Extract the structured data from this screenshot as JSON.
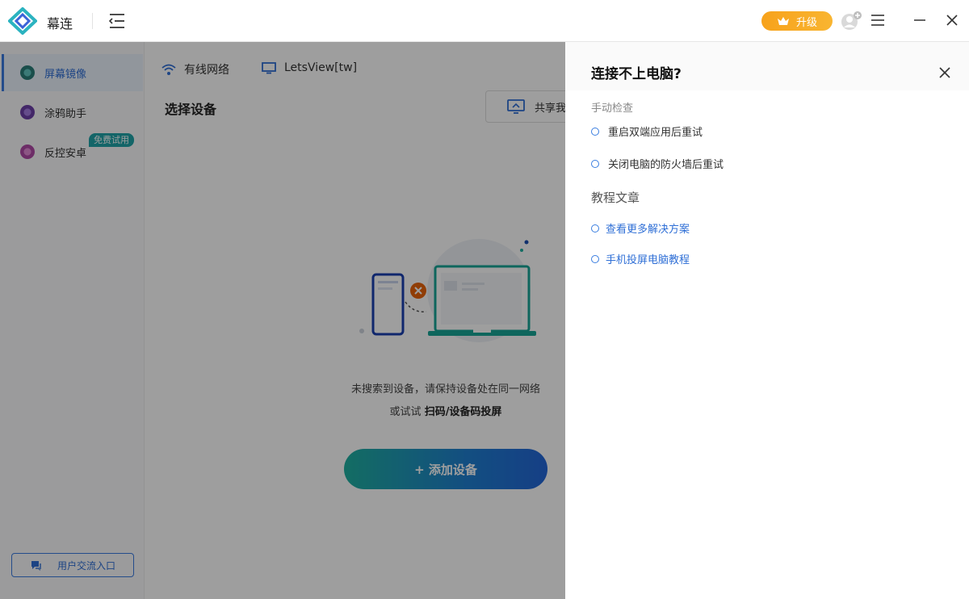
{
  "app": {
    "name": "幕连"
  },
  "titlebar": {
    "upgrade_label": "升级"
  },
  "sidebar": {
    "items": [
      {
        "label": "屏幕镜像",
        "active": true,
        "color": "#2a7f7a"
      },
      {
        "label": "涂鸦助手",
        "active": false,
        "color": "#6d3fa8"
      },
      {
        "label": "反控安卓",
        "active": false,
        "color": "#b04aa6"
      }
    ],
    "free_badge": "免费试用",
    "community_label": "用户交流入口"
  },
  "main": {
    "tabs": [
      {
        "label": "有线网络",
        "icon": "wifi-icon"
      },
      {
        "label": "LetsView[tw]",
        "icon": "monitor-icon"
      }
    ],
    "section_title": "选择设备",
    "share_label": "共享我",
    "empty_line1": "未搜索到设备，请保持设备处在同一网络",
    "empty_line2_prefix": "或试试 ",
    "empty_line2_bold": "扫码/设备码投屏",
    "add_device_label": "+ 添加设备"
  },
  "help_panel": {
    "title": "连接不上电脑?",
    "manual_check_title": "手动检查",
    "checks": [
      "重启双端应用后重试",
      "关闭电脑的防火墙后重试"
    ],
    "tutorial_title": "教程文章",
    "links": [
      "查看更多解决方案",
      "手机投屏电脑教程"
    ]
  },
  "colors": {
    "accent": "#2f6fd6",
    "upgrade": "#f7a21b",
    "teal": "#1fa3a8"
  }
}
